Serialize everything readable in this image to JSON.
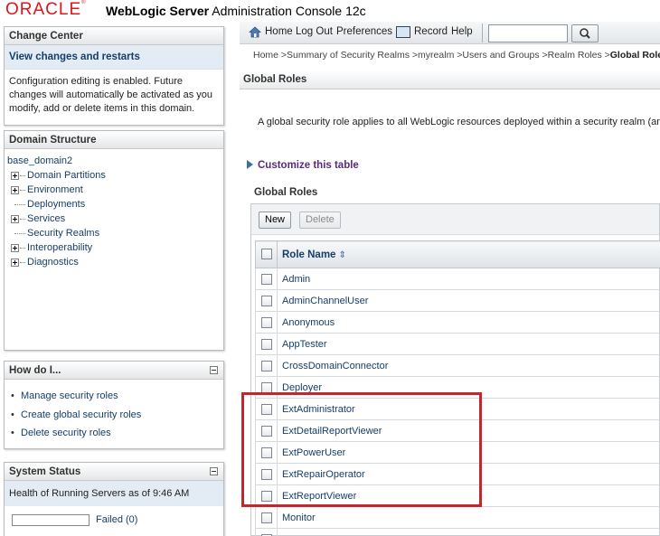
{
  "header": {
    "logo_text": "ORACLE",
    "product_bold": "WebLogic Server",
    "product_rest": "Administration Console 12c"
  },
  "change_center": {
    "title": "Change Center",
    "link": "View changes and restarts",
    "text": "Configuration editing is enabled. Future changes will automatically be activated as you modify, add or delete items in this domain."
  },
  "domain_structure": {
    "title": "Domain Structure",
    "root": "base_domain2",
    "items": [
      {
        "label": "Domain Partitions",
        "expandable": true
      },
      {
        "label": "Environment",
        "expandable": true
      },
      {
        "label": "Deployments",
        "expandable": false
      },
      {
        "label": "Services",
        "expandable": true
      },
      {
        "label": "Security Realms",
        "expandable": false
      },
      {
        "label": "Interoperability",
        "expandable": true
      },
      {
        "label": "Diagnostics",
        "expandable": true
      }
    ]
  },
  "how_do_i": {
    "title": "How do I...",
    "items": [
      "Manage security roles",
      "Create global security roles",
      "Delete security roles"
    ]
  },
  "system_status": {
    "title": "System Status",
    "health_text": "Health of Running Servers as of  9:46 AM",
    "rows": [
      {
        "label": "Failed (0)"
      }
    ]
  },
  "topnav": {
    "home": "Home",
    "logout": "Log Out",
    "preferences": "Preferences",
    "record": "Record",
    "help": "Help",
    "search_value": ""
  },
  "breadcrumb": {
    "path": "Home >Summary of Security Realms >myrealm >Users and Groups >Realm Roles >",
    "current": "Global Roles"
  },
  "content": {
    "title": "Global Roles",
    "description": "A global security role applies to all WebLogic resources deployed within a security realm (and",
    "customize_link": "Customize this table",
    "table_title": "Global Roles",
    "new_button": "New",
    "delete_button": "Delete",
    "column_header": "Role Name",
    "roles": [
      "Admin",
      "AdminChannelUser",
      "Anonymous",
      "AppTester",
      "CrossDomainConnector",
      "Deployer",
      "ExtAdministrator",
      "ExtDetailReportViewer",
      "ExtPowerUser",
      "ExtRepairOperator",
      "ExtReportViewer",
      "Monitor"
    ]
  },
  "colors": {
    "brand_red": "#e0141b",
    "link_blue": "#153e6a",
    "highlight_red": "#c4262e"
  }
}
